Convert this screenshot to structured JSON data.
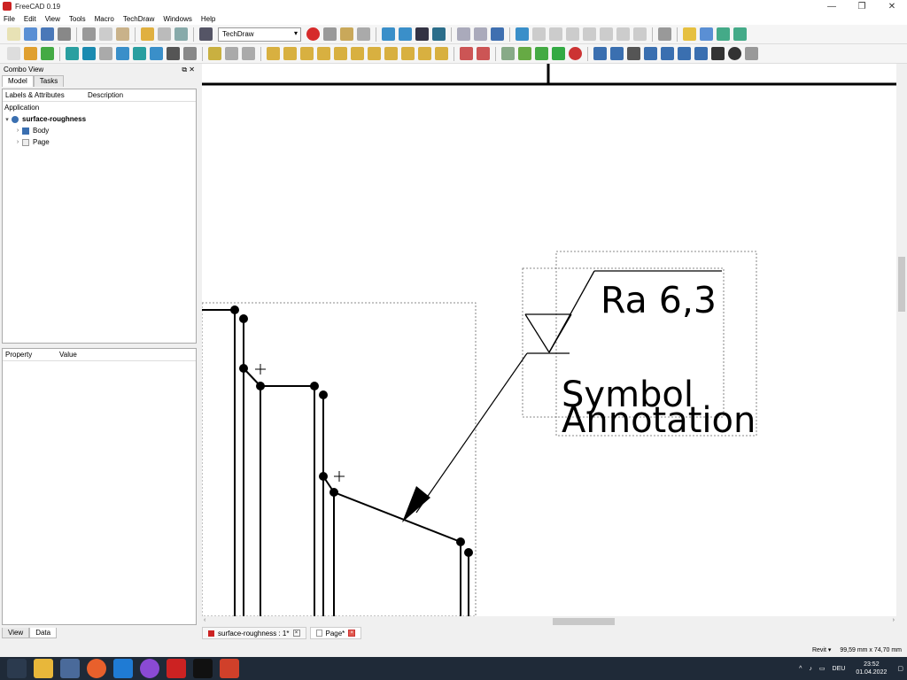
{
  "window": {
    "title": "FreeCAD 0.19",
    "controls": [
      "—",
      "❐",
      "✕"
    ]
  },
  "menu": [
    "File",
    "Edit",
    "View",
    "Tools",
    "Macro",
    "TechDraw",
    "Windows",
    "Help"
  ],
  "toolbar": {
    "workbench": "TechDraw"
  },
  "combo_view": {
    "title": "Combo View",
    "controls": "⧉ ✕",
    "tabs": [
      "Model",
      "Tasks"
    ],
    "tree_headers": [
      "Labels & Attributes",
      "Description"
    ],
    "tree": {
      "root": "Application",
      "document": "surface-roughness",
      "children": [
        "Body",
        "Page"
      ]
    },
    "prop_headers": [
      "Property",
      "Value"
    ],
    "bottom_tabs": [
      "View",
      "Data"
    ]
  },
  "drawing": {
    "roughness_value": "Ra 6,3",
    "symbol_label": "Symbol",
    "annotation_label": "Annotation"
  },
  "doc_tabs": [
    "surface-roughness : 1*",
    "Page*"
  ],
  "status": {
    "nav": "Revit ▾",
    "size": "99,59 mm x 74,70 mm"
  },
  "taskbar": {
    "lang": "DEU",
    "time": "23:52",
    "date": "01.04.2022"
  },
  "colors": {
    "taskbar": "#1f2a38",
    "red_record": "#d62b2b",
    "accent": "#0078d7"
  }
}
